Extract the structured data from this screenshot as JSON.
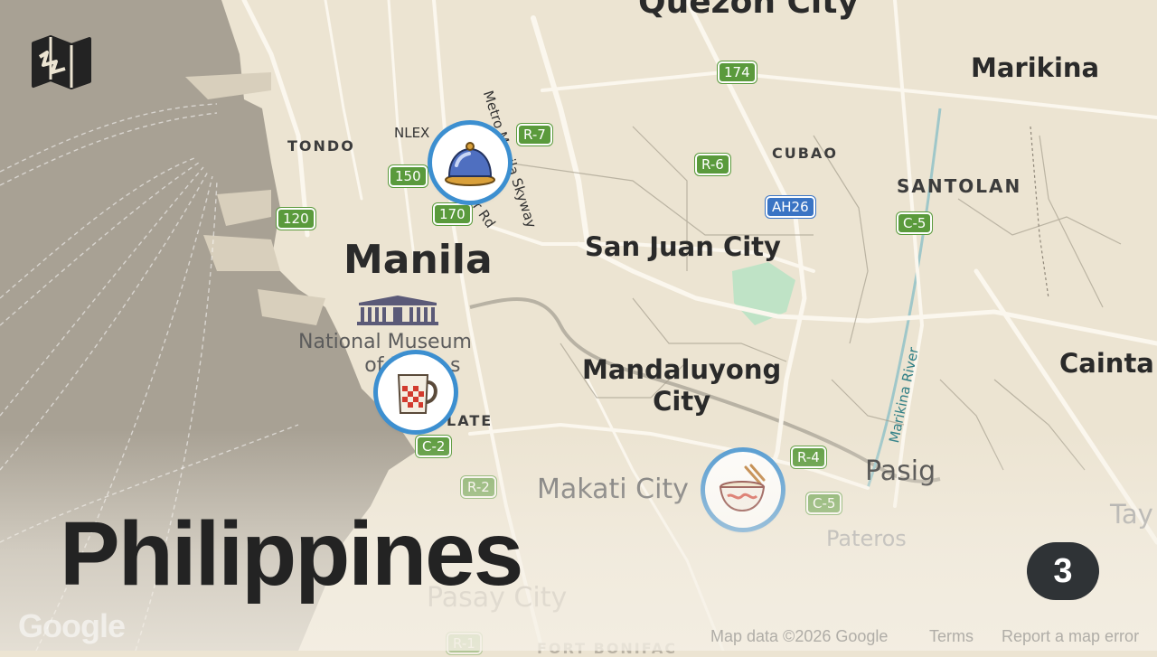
{
  "title": "Philippines",
  "count_badge": "3",
  "map": {
    "cities": [
      {
        "name": "Quezon City"
      },
      {
        "name": "Marikina"
      },
      {
        "name": "Manila"
      },
      {
        "name": "San Juan City"
      },
      {
        "name": "Mandaluyong\nCity"
      },
      {
        "name": "Cainta"
      },
      {
        "name": "Pasig"
      },
      {
        "name": "Makati City"
      },
      {
        "name": "Pateros"
      },
      {
        "name": "Pasay City"
      },
      {
        "name": "Tay"
      }
    ],
    "districts": [
      "TONDO",
      "CUBAO",
      "SANTOLAN",
      "LATE",
      "FORT BONIFAC"
    ],
    "roads": [
      "Metro Manila Skyway",
      "NLEX",
      "r Rd",
      "Marikina River"
    ],
    "poi": {
      "name": "National Museum\nof Fi",
      "name_suffix": "s"
    },
    "shields": [
      {
        "text": "174",
        "color": "#5a9a3c"
      },
      {
        "text": "R-7",
        "color": "#5a9a3c"
      },
      {
        "text": "150",
        "color": "#5a9a3c"
      },
      {
        "text": "170",
        "color": "#5a9a3c"
      },
      {
        "text": "120",
        "color": "#5a9a3c"
      },
      {
        "text": "R-6",
        "color": "#5a9a3c"
      },
      {
        "text": "AH26",
        "color": "#3a74c4"
      },
      {
        "text": "C-5",
        "color": "#5a9a3c"
      },
      {
        "text": "R-4",
        "color": "#5a9a3c"
      },
      {
        "text": "C-5",
        "color": "#5a9a3c"
      },
      {
        "text": "C-2",
        "color": "#5a9a3c"
      },
      {
        "text": "R-2",
        "color": "#5a9a3c"
      },
      {
        "text": "R-1",
        "color": "#5a9a3c"
      }
    ],
    "markers": [
      {
        "icon": "cloche-icon"
      },
      {
        "icon": "mug-icon"
      },
      {
        "icon": "noodle-bowl-icon"
      }
    ]
  },
  "footer": {
    "logo": "Google",
    "map_data": "Map data ©2026 Google",
    "terms": "Terms",
    "report": "Report a map error"
  },
  "colors": {
    "land": "#ece4d2",
    "water": "#a9a296",
    "park": "#bfe3c6",
    "marker_ring": "#3c8fd0",
    "badge": "#2f3336",
    "shield_green": "#5a9a3c",
    "shield_blue": "#3a74c4"
  }
}
